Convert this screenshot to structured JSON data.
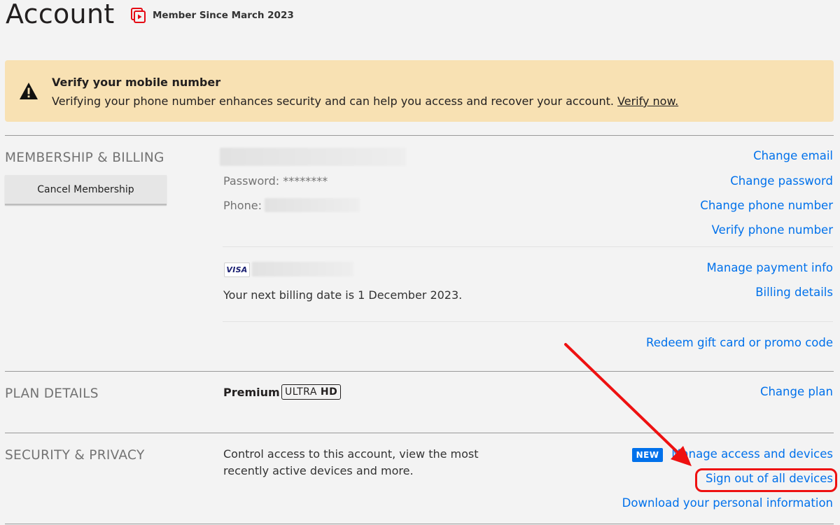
{
  "header": {
    "title": "Account",
    "member_since": "Member Since March 2023",
    "member_icon": "member-badge-icon"
  },
  "banner": {
    "icon": "warning-icon",
    "title": "Verify your mobile number",
    "body": "Verifying your phone number enhances security and can help you access and recover your account. ",
    "link": "Verify now.",
    "bg_color": "#f8e1b3"
  },
  "membership": {
    "heading": "MEMBERSHIP & BILLING",
    "cancel_button": "Cancel Membership",
    "password_label": "Password: ********",
    "phone_label": "Phone:",
    "card_brand": "VISA",
    "next_billing": "Your next billing date is 1 December 2023.",
    "links": {
      "change_email": "Change email",
      "change_password": "Change password",
      "change_phone": "Change phone number",
      "verify_phone": "Verify phone number",
      "manage_payment": "Manage payment info",
      "billing_details": "Billing details",
      "redeem": "Redeem gift card or promo code"
    }
  },
  "plan": {
    "heading": "PLAN DETAILS",
    "name": "Premium",
    "badge_light": "ULTRA",
    "badge_bold": "HD",
    "change_plan": "Change plan"
  },
  "security": {
    "heading": "SECURITY & PRIVACY",
    "description_line1": "Control access to this account, view the most",
    "description_line2": "recently active devices and more.",
    "new_badge": "NEW",
    "manage_access": "Manage access and devices",
    "sign_out_all": "Sign out of all devices",
    "download_info": "Download your personal information"
  },
  "annotation": {
    "arrow_color": "#ee1111"
  },
  "colors": {
    "link": "#0071eb",
    "background": "#f3f3f3",
    "brand_red": "#e50914"
  }
}
